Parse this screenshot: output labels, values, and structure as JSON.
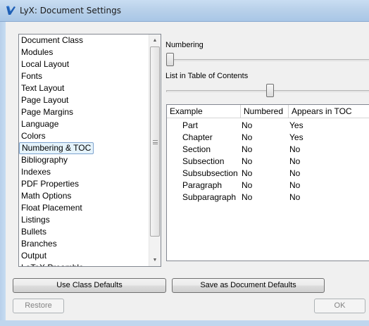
{
  "window": {
    "title": "LyX: Document Settings"
  },
  "categories": [
    "Document Class",
    "Modules",
    "Local Layout",
    "Fonts",
    "Text Layout",
    "Page Layout",
    "Page Margins",
    "Language",
    "Colors",
    "Numbering & TOC",
    "Bibliography",
    "Indexes",
    "PDF Properties",
    "Math Options",
    "Float Placement",
    "Listings",
    "Bullets",
    "Branches",
    "Output",
    "LaTeX Preamble"
  ],
  "selected_category": "Numbering & TOC",
  "numbering": {
    "label": "Numbering",
    "level": 0
  },
  "toc": {
    "label": "List in Table of Contents",
    "level": 0.5
  },
  "table": {
    "headers": [
      "Example",
      "Numbered",
      "Appears in TOC"
    ],
    "rows": [
      [
        "Part",
        "No",
        "Yes"
      ],
      [
        "Chapter",
        "No",
        "Yes"
      ],
      [
        "Section",
        "No",
        "No"
      ],
      [
        "Subsection",
        "No",
        "No"
      ],
      [
        "Subsubsection",
        "No",
        "No"
      ],
      [
        "Paragraph",
        "No",
        "No"
      ],
      [
        "Subparagraph",
        "No",
        "No"
      ]
    ]
  },
  "buttons": {
    "use_class_defaults": "Use Class Defaults",
    "save_as_defaults": "Save as Document Defaults",
    "restore": "Restore",
    "ok": "OK"
  }
}
